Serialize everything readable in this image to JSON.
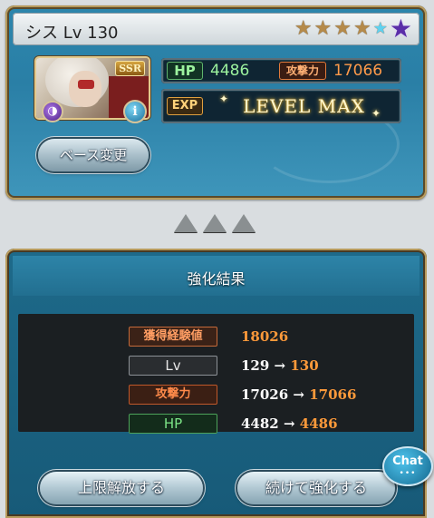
{
  "character": {
    "name": "シス Lv 130",
    "rarity_badge": "SSR",
    "stars_filled": 4,
    "stars_total": 5,
    "hp_label": "HP",
    "hp_value": "4486",
    "atk_label": "攻撃力",
    "atk_value": "17066",
    "exp_label": "EXP",
    "exp_status": "LEVEL MAX",
    "base_change_label": "ベース変更"
  },
  "result": {
    "title": "強化結果",
    "rows": [
      {
        "label": "獲得経験値",
        "value": "18026",
        "from": "",
        "to": ""
      },
      {
        "label": "Lv",
        "from": "129",
        "to": "130"
      },
      {
        "label": "攻撃力",
        "from": "17026",
        "to": "17066"
      },
      {
        "label": "HP",
        "from": "4482",
        "to": "4486"
      }
    ],
    "arrow": "→"
  },
  "buttons": {
    "limit_break": "上限解放する",
    "continue": "続けて強化する"
  },
  "chat": {
    "label": "Chat"
  },
  "colors": {
    "panel_blue": "#2c86ad",
    "accent_orange": "#ff9a3a",
    "hp_green": "#9cf29e",
    "frame_gold": "#b79a5c"
  }
}
